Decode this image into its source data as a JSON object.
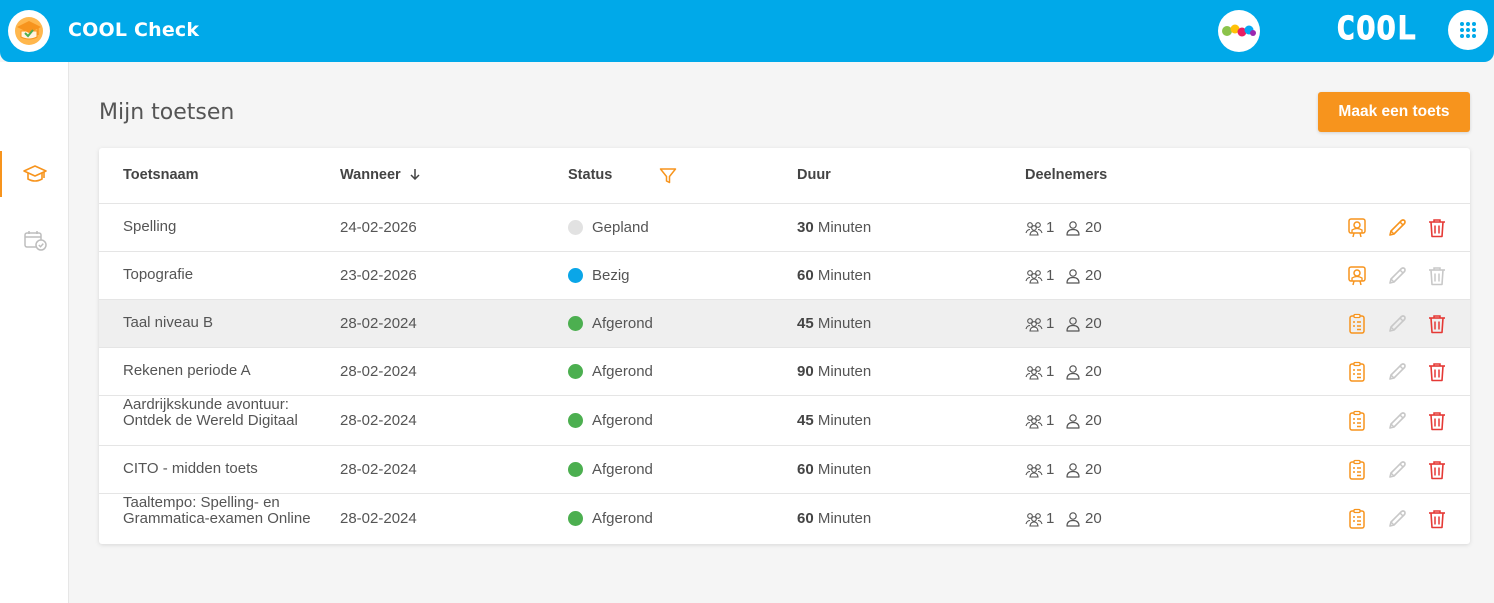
{
  "header": {
    "app_title": "COOL Check",
    "brand": "COOL"
  },
  "page": {
    "title": "Mijn toetsen",
    "create_button": "Maak een toets"
  },
  "table": {
    "columns": {
      "name": "Toetsnaam",
      "when": "Wanneer",
      "status": "Status",
      "duration": "Duur",
      "participants": "Deelnemers"
    },
    "rows": [
      {
        "name": "Spelling",
        "date": "24-02-2026",
        "status": "Gepland",
        "status_color": "#e2e2e2",
        "duration": "30",
        "unit": "Minuten",
        "groups": "1",
        "people": "20",
        "first_action": "presentation",
        "edit_enabled": true,
        "delete_enabled": true
      },
      {
        "name": "Topografie",
        "date": "23-02-2026",
        "status": "Bezig",
        "status_color": "#0aa6e8",
        "duration": "60",
        "unit": "Minuten",
        "groups": "1",
        "people": "20",
        "first_action": "presentation",
        "edit_enabled": false,
        "delete_enabled": false
      },
      {
        "name": "Taal niveau B",
        "date": "28-02-2024",
        "status": "Afgerond",
        "status_color": "#4caf50",
        "duration": "45",
        "unit": "Minuten",
        "groups": "1",
        "people": "20",
        "first_action": "results",
        "edit_enabled": false,
        "delete_enabled": true
      },
      {
        "name": "Rekenen periode A",
        "date": "28-02-2024",
        "status": "Afgerond",
        "status_color": "#4caf50",
        "duration": "90",
        "unit": "Minuten",
        "groups": "1",
        "people": "20",
        "first_action": "results",
        "edit_enabled": false,
        "delete_enabled": true
      },
      {
        "name": "Aardrijkskunde avontuur: Ontdek de Wereld Digitaal",
        "date": "28-02-2024",
        "status": "Afgerond",
        "status_color": "#4caf50",
        "duration": "45",
        "unit": "Minuten",
        "groups": "1",
        "people": "20",
        "first_action": "results",
        "edit_enabled": false,
        "delete_enabled": true
      },
      {
        "name": "CITO - midden toets",
        "date": "28-02-2024",
        "status": "Afgerond",
        "status_color": "#4caf50",
        "duration": "60",
        "unit": "Minuten",
        "groups": "1",
        "people": "20",
        "first_action": "results",
        "edit_enabled": false,
        "delete_enabled": true
      },
      {
        "name": "Taaltempo: Spelling- en Grammatica-examen Online",
        "date": "28-02-2024",
        "status": "Afgerond",
        "status_color": "#4caf50",
        "duration": "60",
        "unit": "Minuten",
        "groups": "1",
        "people": "20",
        "first_action": "results",
        "edit_enabled": false,
        "delete_enabled": true
      }
    ]
  },
  "colors": {
    "header": "#00a9e9",
    "accent": "#f7941d",
    "delete": "#e53935",
    "disabled": "#c8c8c8"
  }
}
